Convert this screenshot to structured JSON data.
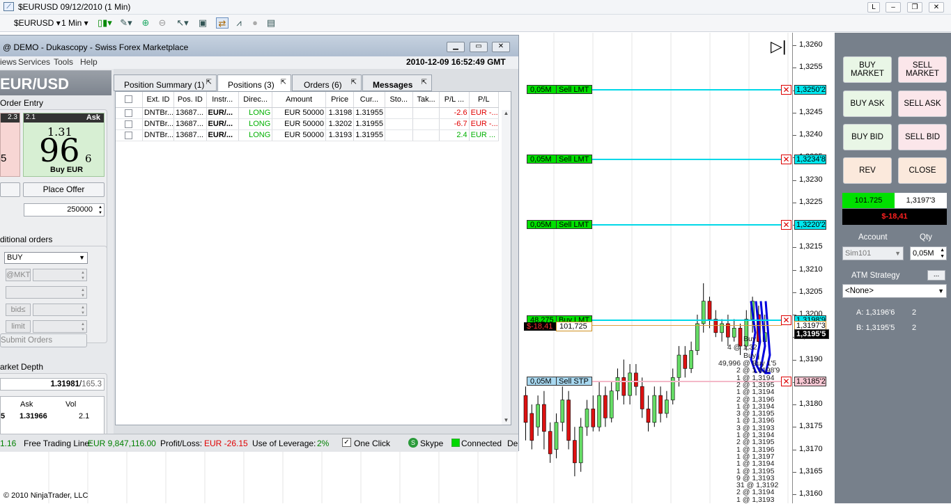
{
  "window": {
    "title": "$EURUSD  09/12/2010 (1 Min)",
    "buttons": [
      "L",
      "–",
      "❐",
      "✕"
    ]
  },
  "toolbar": {
    "instrument": "$EURUSD",
    "interval": "1 Min"
  },
  "chart": {
    "price_ticks": [
      "1,3260",
      "1,3255",
      "1,3250",
      "1,3245",
      "1,3240",
      "1,3235",
      "1,3230",
      "1,3225",
      "1,3220",
      "1,3215",
      "1,3210",
      "1,3205",
      "1,3200",
      "1,3195",
      "1,3190",
      "1,3185",
      "1,3180",
      "1,3175",
      "1,3170",
      "1,3165",
      "1,3160"
    ],
    "orders": [
      {
        "qty": "0,05M",
        "type": "Sell LMT",
        "price": "1,3250'2",
        "color": "#00e000"
      },
      {
        "qty": "0,05M",
        "type": "Sell LMT",
        "price": "1,3234'8",
        "color": "#00e000"
      },
      {
        "qty": "0,05M",
        "type": "Sell LMT",
        "price": "1,3220'2",
        "color": "#00e000"
      },
      {
        "qty": "48,275",
        "type": "Buy LMT",
        "price": "1,3198'9",
        "color": "#00e000"
      },
      {
        "qty": "0,05M",
        "type": "Sell STP",
        "price": "1,3185'2",
        "color": "#a8d8f0"
      }
    ],
    "position_tag": {
      "pnl": "$-18,41",
      "qty": "101,725",
      "price": "1,3197'3"
    },
    "last_price": "1,3195'5",
    "execution_labels": [
      "Buy",
      "4 @ 1,32",
      "Buy",
      "49,996 @ Buy 1'5",
      "2 @ 1,3198'9",
      "1 @ 1,3194",
      "2 @ 1,3195",
      "1 @ 1,3194",
      "2 @ 1,3196",
      "1 @ 1,3194",
      "3 @ 1,3195",
      "1 @ 1,3196",
      "3 @ 1,3193",
      "1 @ 1,3194",
      "2 @ 1,3195",
      "1 @ 1,3196",
      "1 @ 1,3197",
      "1 @ 1,3194",
      "1 @ 1,3195",
      "9 @ 1,3193",
      "31 @ 1,3192",
      "2 @ 1,3194",
      "1 @ 1,3193"
    ],
    "copyright": "© 2010 NinjaTrader, LLC"
  },
  "chart_trader": {
    "buttons": {
      "buy_market": "BUY MARKET",
      "sell_market": "SELL MARKET",
      "buy_ask": "BUY ASK",
      "sell_ask": "SELL ASK",
      "buy_bid": "BUY BID",
      "sell_bid": "SELL BID",
      "rev": "REV",
      "close": "CLOSE"
    },
    "position_qty": "101.725",
    "position_price": "1,3197'3",
    "pnl": "$-18,41",
    "account_label": "Account",
    "account_value": "Sim101",
    "qty_label": "Qty",
    "qty_value": "0,05M",
    "atm_label": "ATM Strategy",
    "atm_button": "...",
    "atm_value": "<None>",
    "ask_label": "A: 1,3196'6",
    "ask_size": "2",
    "bid_label": "B: 1,3195'5",
    "bid_size": "2"
  },
  "dialog": {
    "title": "@ DEMO - Dukascopy - Swiss Forex Marketplace",
    "menu": [
      "iews",
      "Services",
      "Tools",
      "Help"
    ],
    "timestamp": "2010-12-09 16:52:49  GMT",
    "pair": "EUR/USD",
    "order_entry_label": "Order Entry",
    "bid_spread": "2.3",
    "bid_digit": "5",
    "ask_spread": "2.1",
    "ask_label": "Ask",
    "ask_big_prefix": "1.31",
    "ask_big": "96",
    "ask_pip": "6",
    "buy_eur": "Buy EUR",
    "place_offer": "Place Offer",
    "amount": "250000",
    "conditional_label": "ditional orders",
    "side_value": "BUY",
    "mkt_label": "@MKT",
    "bid_cond": "bid≤",
    "limit_label": "limit",
    "submit_orders": "Submit Orders",
    "market_depth_label": "arket Depth",
    "depth_price": "1.31981",
    "depth_sep": "/",
    "depth_spread": "165.3",
    "depth_ask_col": "Ask",
    "depth_vol_col": "Vol",
    "depth_row_left": "5",
    "depth_row_ask": "1.31966",
    "depth_row_vol": "2.1",
    "tabs": [
      {
        "label": "Position Summary (1)"
      },
      {
        "label": "Positions (3)"
      },
      {
        "label": "Orders (6)"
      },
      {
        "label": "Messages"
      }
    ],
    "columns": [
      "",
      "Ext. ID",
      "Pos. ID",
      "Instr...",
      "Direc...",
      "Amount",
      "Price",
      "Cur...",
      "Sto...",
      "Tak...",
      "P/L ...",
      "P/L"
    ],
    "rows": [
      {
        "ext": "DNTBr...",
        "pos": "13687...",
        "instr": "EUR/...",
        "dir": "LONG",
        "amount": "EUR 50000",
        "price": "1.3198",
        "cur": "1.31955",
        "stop": "",
        "take": "",
        "pl_pips": "-2.6",
        "pl": "EUR -..."
      },
      {
        "ext": "DNTBr...",
        "pos": "13687...",
        "instr": "EUR/...",
        "dir": "LONG",
        "amount": "EUR 50000",
        "price": "1.3202",
        "cur": "1.31955",
        "stop": "",
        "take": "",
        "pl_pips": "-6.7",
        "pl": "EUR -..."
      },
      {
        "ext": "DNTBr...",
        "pos": "13687...",
        "instr": "EUR/...",
        "dir": "LONG",
        "amount": "EUR 50000",
        "price": "1.3193",
        "cur": "1.31955",
        "stop": "",
        "take": "",
        "pl_pips": "2.4",
        "pl": "EUR ..."
      }
    ],
    "status": {
      "left_val": "1.16",
      "free_label": "Free Trading Line:",
      "free_val": "EUR 9,847,116.00",
      "pl_label": "Profit/Loss:",
      "pl_val": "EUR -26.15",
      "lev_label": "Use of Leverage:",
      "lev_val": "2%",
      "one_click": "One Click",
      "skype": "Skype",
      "connected": "Connected",
      "trail": "De"
    }
  },
  "colors": {
    "positive": "#00b000",
    "negative": "#e00000",
    "order_line": "#00d8e8",
    "stop_line": "#f4b8c8",
    "panel_bg": "#77808b"
  }
}
